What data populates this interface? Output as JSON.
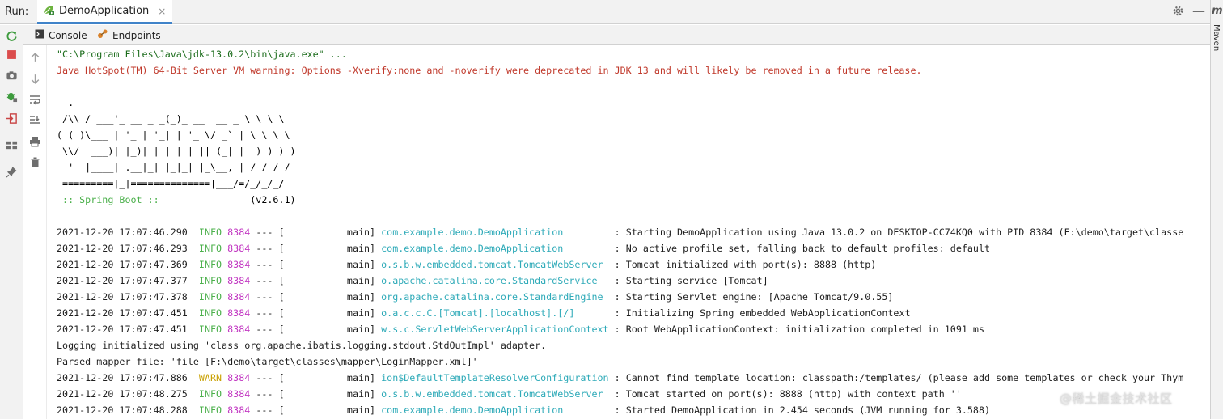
{
  "topbar": {
    "run_label": "Run:",
    "tab_label": "DemoApplication",
    "tab_close": "×",
    "gear_icon": "gear-icon",
    "minimize_glyph": "—"
  },
  "rightbar": {
    "maven_glyph": "m",
    "maven_label": "Maven"
  },
  "subtabs": {
    "console_label": "Console",
    "endpoints_label": "Endpoints"
  },
  "console": {
    "command": "\"C:\\Program Files\\Java\\jdk-13.0.2\\bin\\java.exe\" ...",
    "jvm_warning": "Java HotSpot(TM) 64-Bit Server VM warning: Options -Xverify:none and -noverify were deprecated in JDK 13 and will likely be removed in a future release.",
    "banner": [
      "  .   ____          _            __ _ _",
      " /\\\\ / ___'_ __ _ _(_)_ __  __ _ \\ \\ \\ \\",
      "( ( )\\___ | '_ | '_| | '_ \\/ _` | \\ \\ \\ \\",
      " \\\\/  ___)| |_)| | | | | || (_| |  ) ) ) )",
      "  '  |____| .__|_| |_|_| |_\\__, | / / / /",
      " =========|_|==============|___/=/_/_/_/"
    ],
    "spring_boot_label": " :: Spring Boot :: ",
    "spring_boot_version": "               (v2.6.1)",
    "logs_a": [
      {
        "ts": "2021-12-20 17:07:46.290",
        "level": "INFO",
        "pid": "8384",
        "sep": " --- [           main] ",
        "logger": "com.example.demo.DemoApplication        ",
        "msg": " : Starting DemoApplication using Java 13.0.2 on DESKTOP-CC74KQ0 with PID 8384 (F:\\demo\\target\\classe"
      },
      {
        "ts": "2021-12-20 17:07:46.293",
        "level": "INFO",
        "pid": "8384",
        "sep": " --- [           main] ",
        "logger": "com.example.demo.DemoApplication        ",
        "msg": " : No active profile set, falling back to default profiles: default"
      },
      {
        "ts": "2021-12-20 17:07:47.369",
        "level": "INFO",
        "pid": "8384",
        "sep": " --- [           main] ",
        "logger": "o.s.b.w.embedded.tomcat.TomcatWebServer ",
        "msg": " : Tomcat initialized with port(s): 8888 (http)"
      },
      {
        "ts": "2021-12-20 17:07:47.377",
        "level": "INFO",
        "pid": "8384",
        "sep": " --- [           main] ",
        "logger": "o.apache.catalina.core.StandardService  ",
        "msg": " : Starting service [Tomcat]"
      },
      {
        "ts": "2021-12-20 17:07:47.378",
        "level": "INFO",
        "pid": "8384",
        "sep": " --- [           main] ",
        "logger": "org.apache.catalina.core.StandardEngine ",
        "msg": " : Starting Servlet engine: [Apache Tomcat/9.0.55]"
      },
      {
        "ts": "2021-12-20 17:07:47.451",
        "level": "INFO",
        "pid": "8384",
        "sep": " --- [           main] ",
        "logger": "o.a.c.c.C.[Tomcat].[localhost].[/]      ",
        "msg": " : Initializing Spring embedded WebApplicationContext"
      },
      {
        "ts": "2021-12-20 17:07:47.451",
        "level": "INFO",
        "pid": "8384",
        "sep": " --- [           main] ",
        "logger": "w.s.c.ServletWebServerApplicationContext",
        "msg": " : Root WebApplicationContext: initialization completed in 1091 ms"
      }
    ],
    "plain_line_1": "Logging initialized using 'class org.apache.ibatis.logging.stdout.StdOutImpl' adapter.",
    "plain_line_2": "Parsed mapper file: 'file [F:\\demo\\target\\classes\\mapper\\LoginMapper.xml]'",
    "logs_b": [
      {
        "ts": "2021-12-20 17:07:47.886",
        "level": "WARN",
        "pid": "8384",
        "sep": " --- [           main] ",
        "logger": "ion$DefaultTemplateResolverConfiguration",
        "msg": " : Cannot find template location: classpath:/templates/ (please add some templates or check your Thym"
      },
      {
        "ts": "2021-12-20 17:07:48.275",
        "level": "INFO",
        "pid": "8384",
        "sep": " --- [           main] ",
        "logger": "o.s.b.w.embedded.tomcat.TomcatWebServer ",
        "msg": " : Tomcat started on port(s): 8888 (http) with context path ''"
      },
      {
        "ts": "2021-12-20 17:07:48.288",
        "level": "INFO",
        "pid": "8384",
        "sep": " --- [           main] ",
        "logger": "com.example.demo.DemoApplication        ",
        "msg": " : Started DemoApplication in 2.454 seconds (JVM running for 3.588)"
      }
    ]
  },
  "watermark": "@稀土掘金技术社区",
  "colors": {
    "tab_underline": "#4083c9",
    "jvm_warning": "#c0392b",
    "info": "#4bb04b",
    "warn": "#c9a000",
    "pid": "#c238c2",
    "logger": "#2eaab8",
    "command": "#1a6b1a"
  }
}
